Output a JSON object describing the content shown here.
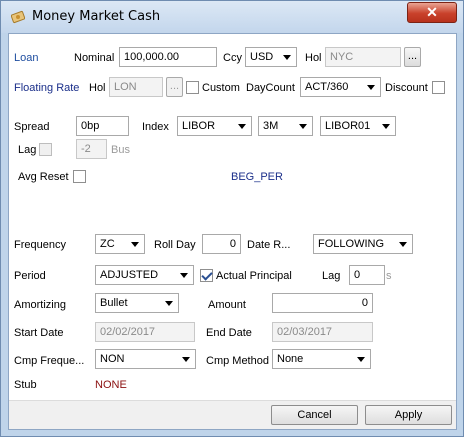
{
  "window": {
    "title": "Money Market Cash",
    "icon": "money-icon",
    "close_icon": "close-icon"
  },
  "loan": {
    "section_label": "Loan",
    "nominal_label": "Nominal",
    "nominal_value": "100,000.00",
    "ccy_label": "Ccy",
    "ccy_value": "USD",
    "hol_label": "Hol",
    "hol_value": "NYC",
    "ellipsis": "..."
  },
  "floating": {
    "section_label": "Floating Rate",
    "hol_label": "Hol",
    "hol_value": "LON",
    "ellipsis": "...",
    "custom_label": "Custom",
    "custom_checked": false,
    "daycount_label": "DayCount",
    "daycount_value": "ACT/360",
    "discount_label": "Discount",
    "discount_checked": false
  },
  "spread": {
    "label": "Spread",
    "value": "0bp",
    "index_label": "Index",
    "index_value": "LIBOR",
    "tenor_value": "3M",
    "source_value": "LIBOR01",
    "lag_label": "Lag",
    "lag_checked": false,
    "lag_value": "-2",
    "lag_unit": "Bus",
    "avg_reset_label": "Avg Reset",
    "avg_reset_checked": false,
    "reset_mode": "BEG_PER"
  },
  "schedule": {
    "frequency_label": "Frequency",
    "frequency_value": "ZC",
    "roll_day_label": "Roll Day",
    "roll_day_value": "0",
    "date_roll_label": "Date R...",
    "date_roll_value": "FOLLOWING",
    "period_label": "Period",
    "period_value": "ADJUSTED",
    "actual_principal_label": "Actual Principal",
    "actual_principal_checked": true,
    "lag_label": "Lag",
    "lag_value": "0",
    "lag_suffix": "s",
    "amortizing_label": "Amortizing",
    "amortizing_value": "Bullet",
    "amount_label": "Amount",
    "amount_value": "0",
    "start_date_label": "Start Date",
    "start_date_value": "02/02/2017",
    "end_date_label": "End Date",
    "end_date_value": "02/03/2017",
    "cmp_freq_label": "Cmp Freque...",
    "cmp_freq_value": "NON",
    "cmp_method_label": "Cmp Method",
    "cmp_method_value": "None",
    "stub_label": "Stub",
    "stub_value": "NONE"
  },
  "footer": {
    "cancel_label": "Cancel",
    "apply_label": "Apply"
  },
  "colors": {
    "section_label": "#1b2f8a",
    "stub_value": "#8b1010",
    "titlebar": "#c3d6ec"
  }
}
